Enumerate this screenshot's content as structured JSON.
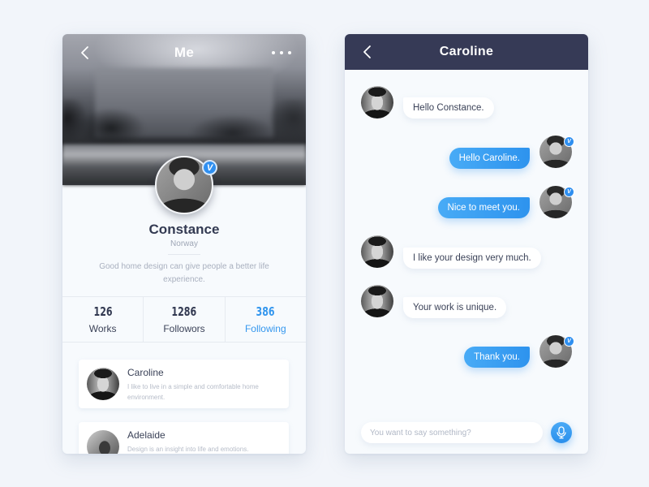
{
  "profile": {
    "nav": {
      "title": "Me",
      "back_icon": "chevron-left-icon",
      "more_icon": "more-horizontal-icon"
    },
    "user": {
      "name": "Constance",
      "location": "Norway",
      "bio": "Good home design can give people a better life experience.",
      "verified_badge": "V"
    },
    "stats": [
      {
        "value": "126",
        "label": "Works",
        "active": false
      },
      {
        "value": "1286",
        "label": "Followors",
        "active": false
      },
      {
        "value": "386",
        "label": "Following",
        "active": true
      }
    ],
    "contacts": [
      {
        "name": "Caroline",
        "message": "I like to live in a simple and comfortable home environment."
      },
      {
        "name": "Adelaide",
        "message": "Design is an insight into life and emotions."
      }
    ]
  },
  "chat": {
    "title": "Caroline",
    "back_icon": "chevron-left-icon",
    "messages": [
      {
        "from": "Caroline",
        "direction": "in",
        "text": "Hello Constance."
      },
      {
        "from": "Constance",
        "direction": "out",
        "text": "Hello Caroline."
      },
      {
        "from": "Constance",
        "direction": "out",
        "text": "Nice to meet you."
      },
      {
        "from": "Caroline",
        "direction": "in",
        "text": "I like your design very much."
      },
      {
        "from": "Caroline",
        "direction": "in",
        "text": "Your work is unique."
      },
      {
        "from": "Constance",
        "direction": "out",
        "text": "Thank you."
      }
    ],
    "verified_badge": "V",
    "input": {
      "placeholder": "You want to say something?",
      "value": ""
    },
    "mic_icon": "microphone-icon"
  },
  "colors": {
    "accent": "#3597ee",
    "chat_header": "#363a56",
    "text_dark": "#333a52",
    "background": "#f2f5fa"
  }
}
